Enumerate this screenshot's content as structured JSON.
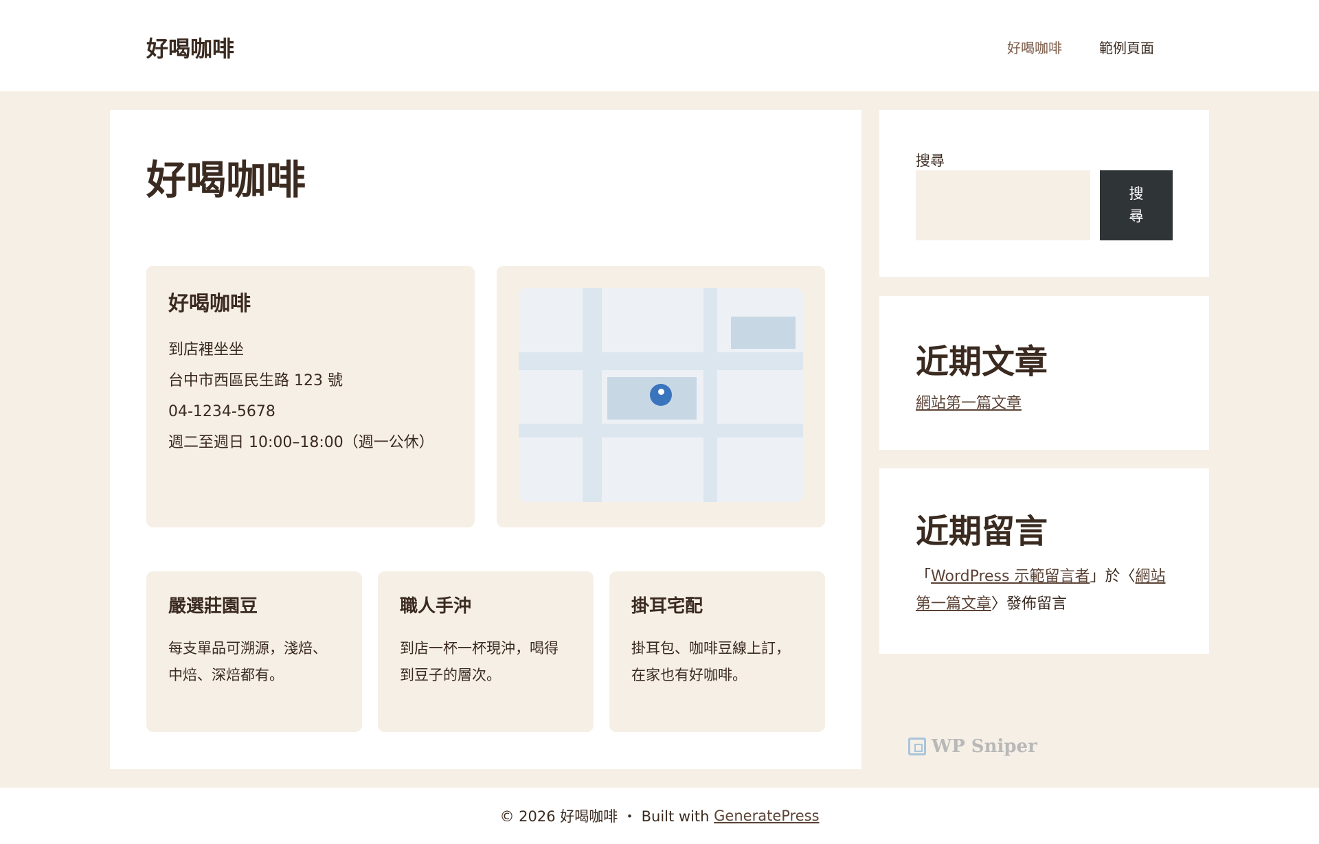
{
  "header": {
    "site_title": "好喝咖啡",
    "nav": [
      {
        "label": "好喝咖啡"
      },
      {
        "label": "範例頁面"
      }
    ]
  },
  "main": {
    "page_title": "好喝咖啡",
    "info": {
      "title": "好喝咖啡",
      "lines": [
        "到店裡坐坐",
        "台中市西區民生路 123 號",
        "04-1234-5678",
        "週二至週日 10:00–18:00（週一公休）"
      ]
    },
    "features": [
      {
        "title": "嚴選莊園豆",
        "text": "每支單品可溯源，淺焙、中焙、深焙都有。"
      },
      {
        "title": "職人手沖",
        "text": "到店一杯一杯現沖，喝得到豆子的層次。"
      },
      {
        "title": "掛耳宅配",
        "text": "掛耳包、咖啡豆線上訂，在家也有好咖啡。"
      }
    ]
  },
  "sidebar": {
    "search": {
      "label": "搜尋",
      "button_label": "搜尋",
      "value": ""
    },
    "recent_posts": {
      "title": "近期文章",
      "items": [
        "網站第一篇文章"
      ]
    },
    "recent_comments": {
      "title": "近期留言",
      "open_quote": "「",
      "author": "WordPress 示範留言者",
      "mid_text": "」於〈",
      "post": "網站第一篇文章",
      "end_text": "〉發佈留言"
    }
  },
  "watermark": {
    "text": "WP Sniper"
  },
  "footer": {
    "copyright": "© 2026 好喝咖啡 ・ Built with ",
    "link": "GeneratePress"
  },
  "colors": {
    "background": "#f6efe6",
    "text": "#3a2a20",
    "button": "#2f3437",
    "map_pin": "#3a74bc"
  }
}
